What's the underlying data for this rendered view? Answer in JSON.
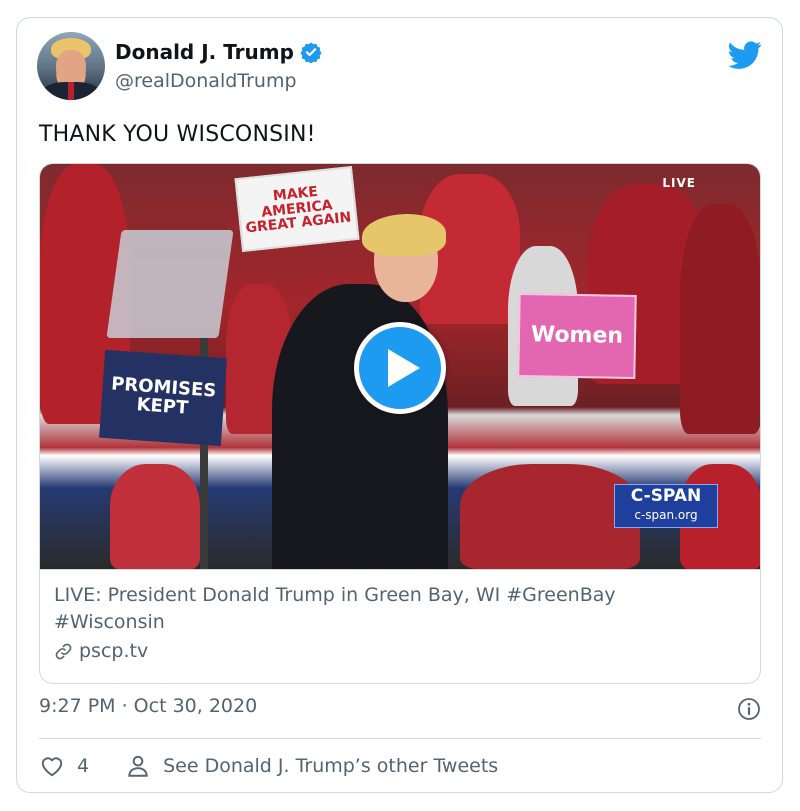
{
  "author": {
    "display_name": "Donald J. Trump",
    "handle": "@realDonaldTrump",
    "avatar_icon": "avatar-photo",
    "verified_icon": "verified-badge-icon"
  },
  "brand": {
    "icon": "twitter-bird-icon",
    "color": "#1d9bf0"
  },
  "tweet": {
    "text": "THANK YOU WISCONSIN!",
    "timestamp": "9:27 PM · Oct 30, 2020"
  },
  "media": {
    "live_label": "LIVE",
    "signs": {
      "make_america": "MAKE AMERICA GREAT AGAIN",
      "women": "Women",
      "promises": "PROMISES KEPT"
    },
    "network_badge": {
      "title": "C-SPAN",
      "url": "c-span.org"
    },
    "play_icon": "play-icon",
    "link": {
      "title": "LIVE: President Donald Trump in Green Bay, WI #GreenBay #Wisconsin",
      "domain": "pscp.tv",
      "icon": "link-icon"
    }
  },
  "actions": {
    "like_count": "4",
    "like_icon": "heart-icon",
    "profile_link": "See Donald J. Trump’s other Tweets",
    "profile_icon": "person-icon"
  },
  "colors": {
    "text_primary": "#0f1419",
    "text_secondary": "#536471",
    "border": "#cfd9de"
  }
}
